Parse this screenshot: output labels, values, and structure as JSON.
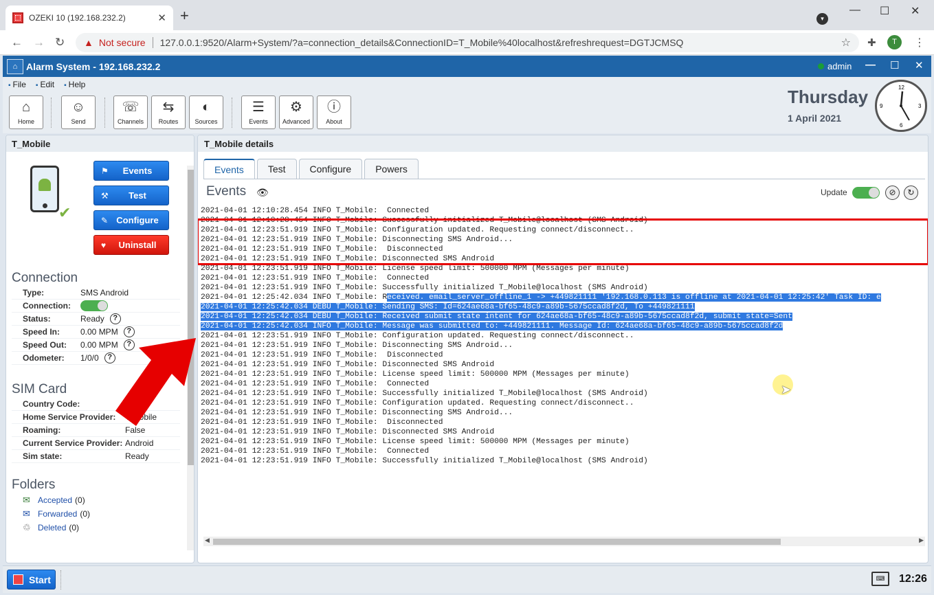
{
  "browser": {
    "tab_title": "OZEKI 10 (192.168.232.2)",
    "tab_close": "✕",
    "new_tab": "+",
    "minimize": "—",
    "maximize": "☐",
    "close": "✕",
    "not_secure": "Not secure",
    "url": "127.0.0.1:9520/Alarm+System/?a=connection_details&ConnectionID=T_Mobile%40localhost&refreshrequest=DGTJCMSQ",
    "profile_initial": "T"
  },
  "app": {
    "title": "Alarm System - 192.168.232.2",
    "user": "admin",
    "menu": [
      "File",
      "Edit",
      "Help"
    ],
    "toolbar": [
      {
        "label": "Home",
        "icon": "home-icon"
      },
      {
        "label": "Send",
        "icon": "send-icon"
      },
      {
        "label": "Channels",
        "icon": "channels-icon"
      },
      {
        "label": "Routes",
        "icon": "routes-icon"
      },
      {
        "label": "Sources",
        "icon": "sources-icon"
      },
      {
        "label": "Events",
        "icon": "events-icon"
      },
      {
        "label": "Advanced",
        "icon": "gear-icon"
      },
      {
        "label": "About",
        "icon": "info-icon"
      }
    ],
    "day": "Thursday",
    "date": "1 April 2021"
  },
  "left": {
    "title": "T_Mobile",
    "actions": {
      "events": "Events",
      "test": "Test",
      "configure": "Configure",
      "uninstall": "Uninstall"
    },
    "connection": {
      "heading": "Connection",
      "type_label": "Type:",
      "type": "SMS Android",
      "connection_label": "Connection:",
      "status_label": "Status:",
      "status": "Ready",
      "speed_in_label": "Speed In:",
      "speed_in": "0.00 MPM",
      "speed_out_label": "Speed Out:",
      "speed_out": "0.00 MPM",
      "odometer_label": "Odometer:",
      "odometer": "1/0/0"
    },
    "sim": {
      "heading": "SIM Card",
      "country_label": "Country Code:",
      "country": "US",
      "home_label": "Home Service Provider:",
      "home": "T-Mobile",
      "roaming_label": "Roaming:",
      "roaming": "False",
      "current_label": "Current Service Provider:",
      "current": "Android",
      "state_label": "Sim state:",
      "state": "Ready"
    },
    "folders": {
      "heading": "Folders",
      "accepted": "Accepted",
      "accepted_count": "(0)",
      "forwarded": "Forwarded",
      "forwarded_count": "(0)",
      "deleted": "Deleted",
      "deleted_count": "(0)"
    }
  },
  "right": {
    "title": "T_Mobile details",
    "tabs": [
      "Events",
      "Test",
      "Configure",
      "Powers"
    ],
    "events_title": "Events",
    "update_label": "Update",
    "log": [
      "2021-04-01 12:10:28.454 INFO T_Mobile:  Connected",
      "2021-04-01 12:10:28.454 INFO T_Mobile: Successfully initialized T_Mobile@localhost (SMS Android)",
      "2021-04-01 12:23:51.919 INFO T_Mobile: Configuration updated. Requesting connect/disconnect..",
      "2021-04-01 12:23:51.919 INFO T_Mobile: Disconnecting SMS Android...",
      "2021-04-01 12:23:51.919 INFO T_Mobile:  Disconnected",
      "2021-04-01 12:23:51.919 INFO T_Mobile: Disconnected SMS Android",
      "2021-04-01 12:23:51.919 INFO T_Mobile: License speed limit: 500000 MPM (Messages per minute)",
      "2021-04-01 12:23:51.919 INFO T_Mobile:  Connected",
      "2021-04-01 12:23:51.919 INFO T_Mobile: Successfully initialized T_Mobile@localhost (SMS Android)",
      "2021-04-01 12:25:42.034 INFO T_Mobile: Received. email_server_offline_1 -> +449821111 '192.168.0.113 is offline at 2021-04-01 12:25:42' Task ID: e",
      "2021-04-01 12:25:42.034 DEBU T_Mobile: Sending SMS: Id=624ae68a-bf65-48c9-a89b-5675ccad8f2d, To +449821111",
      "2021-04-01 12:25:42.034 DEBU T_Mobile: Received submit state intent for 624ae68a-bf65-48c9-a89b-5675ccad8f2d, submit state=Sent",
      "2021-04-01 12:25:42.034 INFO T_Mobile: Message was submitted to: +449821111. Message Id: 624ae68a-bf65-48c9-a89b-5675ccad8f2d",
      "2021-04-01 12:23:51.919 INFO T_Mobile: Configuration updated. Requesting connect/disconnect..",
      "2021-04-01 12:23:51.919 INFO T_Mobile: Disconnecting SMS Android...",
      "2021-04-01 12:23:51.919 INFO T_Mobile:  Disconnected",
      "2021-04-01 12:23:51.919 INFO T_Mobile: Disconnected SMS Android",
      "2021-04-01 12:23:51.919 INFO T_Mobile: License speed limit: 500000 MPM (Messages per minute)",
      "2021-04-01 12:23:51.919 INFO T_Mobile:  Connected",
      "2021-04-01 12:23:51.919 INFO T_Mobile: Successfully initialized T_Mobile@localhost (SMS Android)",
      "2021-04-01 12:23:51.919 INFO T_Mobile: Configuration updated. Requesting connect/disconnect..",
      "2021-04-01 12:23:51.919 INFO T_Mobile: Disconnecting SMS Android...",
      "2021-04-01 12:23:51.919 INFO T_Mobile:  Disconnected",
      "2021-04-01 12:23:51.919 INFO T_Mobile: Disconnected SMS Android",
      "2021-04-01 12:23:51.919 INFO T_Mobile: License speed limit: 500000 MPM (Messages per minute)",
      "2021-04-01 12:23:51.919 INFO T_Mobile:  Connected",
      "2021-04-01 12:23:51.919 INFO T_Mobile: Successfully initialized T_Mobile@localhost (SMS Android)"
    ]
  },
  "taskbar": {
    "start": "Start",
    "time": "12:26"
  }
}
